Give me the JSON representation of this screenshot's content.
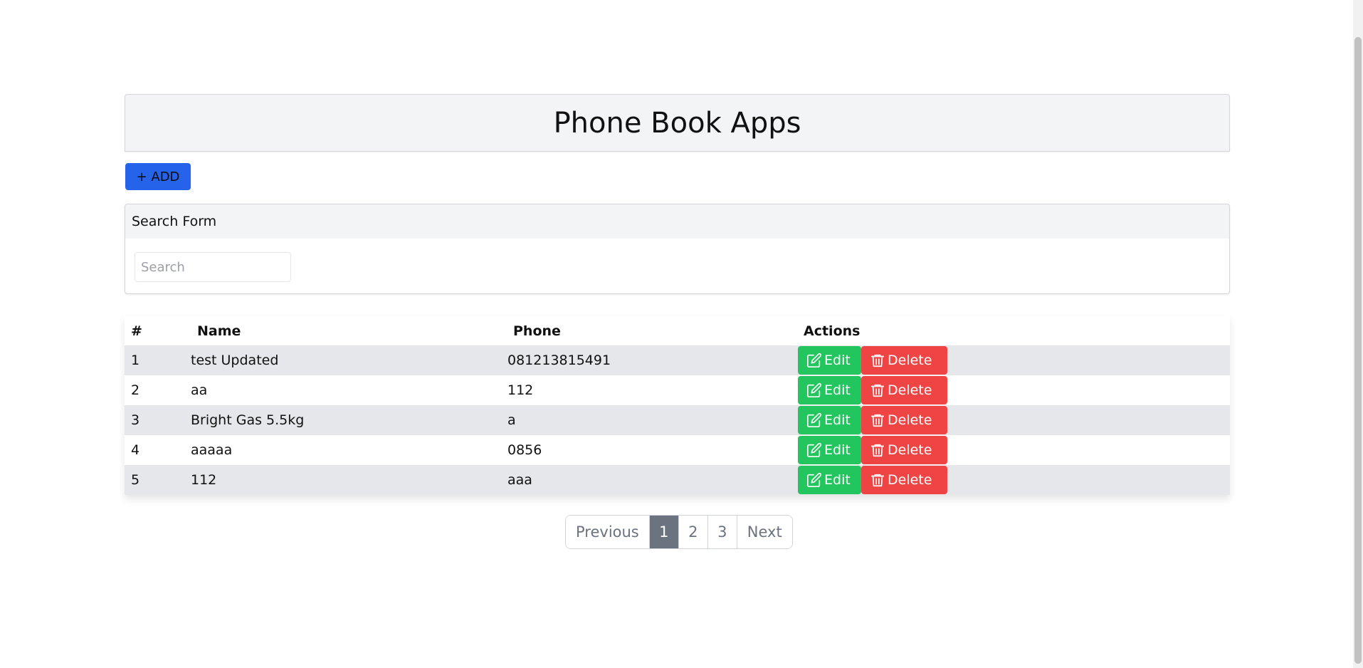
{
  "app": {
    "title": "Phone Book Apps"
  },
  "toolbar": {
    "add_label": "+ ADD"
  },
  "search": {
    "header": "Search Form",
    "placeholder": "Search",
    "value": ""
  },
  "table": {
    "headers": [
      "#",
      "Name",
      "Phone",
      "Actions"
    ],
    "rows": [
      {
        "num": "1",
        "name": "test Updated",
        "phone": "081213815491"
      },
      {
        "num": "2",
        "name": "aa",
        "phone": "112"
      },
      {
        "num": "3",
        "name": "Bright Gas 5.5kg",
        "phone": "a"
      },
      {
        "num": "4",
        "name": "aaaaa",
        "phone": "0856"
      },
      {
        "num": "5",
        "name": "112",
        "phone": "aaa"
      }
    ],
    "edit_label": "Edit",
    "delete_label": "Delete"
  },
  "pagination": {
    "previous": "Previous",
    "pages": [
      "1",
      "2",
      "3"
    ],
    "current": "1",
    "next": "Next"
  },
  "colors": {
    "add_button": "#2563eb",
    "edit_button": "#22c55e",
    "delete_button": "#ef4444",
    "active_page": "#6b7280"
  },
  "icons": {
    "edit": "edit-icon",
    "delete": "trash-icon"
  }
}
